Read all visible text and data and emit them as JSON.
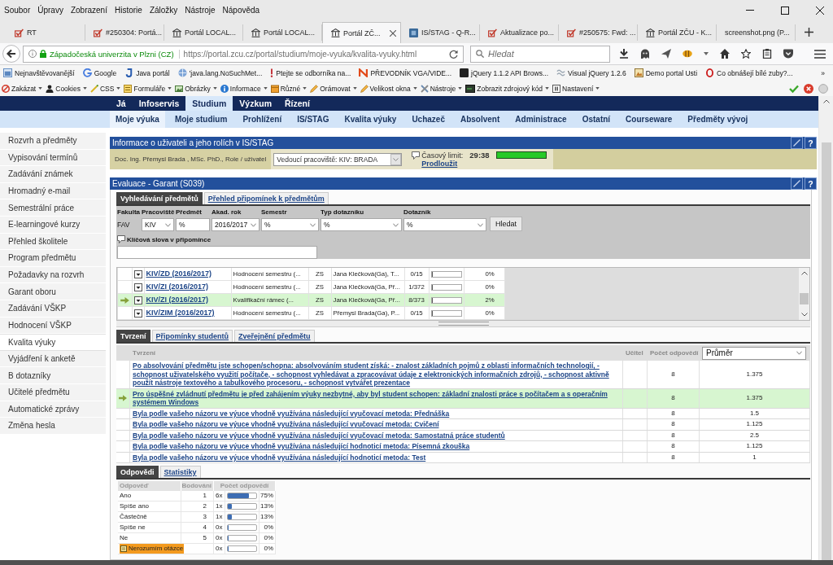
{
  "menu_bar": [
    "Soubor",
    "Úpravy",
    "Zobrazení",
    "Historie",
    "Záložky",
    "Nástroje",
    "Nápověda"
  ],
  "tabs": [
    {
      "label": "RT",
      "kind": "tracker",
      "selected": false
    },
    {
      "label": "#250304: Portá...",
      "kind": "tracker",
      "selected": false
    },
    {
      "label": "Portál LOCAL...",
      "kind": "portal",
      "selected": false
    },
    {
      "label": "Portál LOCAL...",
      "kind": "portal",
      "selected": false
    },
    {
      "label": "Portál ZČ...",
      "kind": "portal",
      "selected": true
    },
    {
      "label": "IS/STAG - Q-R...",
      "kind": "stag",
      "selected": false
    },
    {
      "label": "Aktualizace po...",
      "kind": "tracker",
      "selected": false
    },
    {
      "label": "#250575: Fwd: ...",
      "kind": "tracker",
      "selected": false
    },
    {
      "label": "Portál ZČU - K...",
      "kind": "portal",
      "selected": false
    },
    {
      "label": "screenshot.png (P...",
      "kind": "plain",
      "selected": false
    }
  ],
  "address_bar": {
    "site_identity": "Západočeská univerzita v Plzni (CZ)",
    "url": "https://portal.zcu.cz/portal/studium/moje-vyuka/kvalita-vyuky.html",
    "search_placeholder": "Hledat"
  },
  "bookmarks": [
    {
      "label": "Nejnavštěvovanější",
      "kind": "window"
    },
    {
      "label": "Google",
      "kind": "colorring"
    },
    {
      "label": "Java portál",
      "kind": "hook"
    },
    {
      "label": "'java.lang.NoSuchMet...",
      "kind": "globe"
    },
    {
      "label": "Ptejte se odborníka na...",
      "kind": "exclaim"
    },
    {
      "label": "PŘEVODNÍK VGA/VIDE...",
      "kind": "zigzag"
    },
    {
      "label": "jQuery 1.1.2 API Brows...",
      "kind": "block"
    },
    {
      "label": "Visual jQuery 1.2.6",
      "kind": "wave"
    },
    {
      "label": "Demo portal Usti",
      "kind": "picture"
    },
    {
      "label": "Co obnášejí bílé zuby?...",
      "kind": "ring"
    }
  ],
  "bookmarks_overflow": "»",
  "dev_toolbar": [
    {
      "label": "Zakázat",
      "kind": "prohibit"
    },
    {
      "label": "Cookies",
      "kind": "person"
    },
    {
      "label": "CSS",
      "kind": "wand"
    },
    {
      "label": "Formuláře",
      "kind": "form"
    },
    {
      "label": "Obrázky",
      "kind": "picture"
    },
    {
      "label": "Informace",
      "kind": "info"
    },
    {
      "label": "Různé",
      "kind": "box"
    },
    {
      "label": "Orámovat",
      "kind": "pencil"
    },
    {
      "label": "Velikost okna",
      "kind": "pencil"
    },
    {
      "label": "Nástroje",
      "kind": "tools"
    },
    {
      "label": "Zobrazit zdrojový kód",
      "kind": "console"
    },
    {
      "label": "Nastavení",
      "kind": "panel"
    }
  ],
  "portal": {
    "top_nav": [
      {
        "label": "Já",
        "selected": false
      },
      {
        "label": "Infoservis",
        "selected": false
      },
      {
        "label": "Studium",
        "selected": true
      },
      {
        "label": "Výzkum",
        "selected": false
      },
      {
        "label": "Řízení",
        "selected": false
      }
    ],
    "sub_nav": [
      {
        "label": "Moje výuka",
        "selected": true
      },
      {
        "label": "Moje studium",
        "selected": false
      },
      {
        "label": "Prohlížení",
        "selected": false
      },
      {
        "label": "IS/STAG",
        "selected": false
      },
      {
        "label": "Kvalita výuky",
        "selected": false
      },
      {
        "label": "Uchazeč",
        "selected": false
      },
      {
        "label": "Absolvent",
        "selected": false
      },
      {
        "label": "Administrace",
        "selected": false
      },
      {
        "label": "Ostatní",
        "selected": false
      },
      {
        "label": "Courseware",
        "selected": false
      },
      {
        "label": "Předměty vývoj",
        "selected": false
      }
    ],
    "sidebar": [
      {
        "label": "Rozvrh a předměty",
        "selected": false
      },
      {
        "label": "Vypisování termínů",
        "selected": false
      },
      {
        "label": "Zadávání známek",
        "selected": false
      },
      {
        "label": "Hromadný e-mail",
        "selected": false
      },
      {
        "label": "Semestrální práce",
        "selected": false
      },
      {
        "label": "E-learningové kurzy",
        "selected": false
      },
      {
        "label": "Přehled školitele",
        "selected": false
      },
      {
        "label": "Program předmětu",
        "selected": false
      },
      {
        "label": "Požadavky na rozvrh",
        "selected": false
      },
      {
        "label": "Garant oboru",
        "selected": false
      },
      {
        "label": "Zadávání VŠKP",
        "selected": false
      },
      {
        "label": "Hodnocení VŠKP",
        "selected": false
      },
      {
        "label": "Kvalita výuky",
        "selected": true
      },
      {
        "label": "Vyjádření k anketě",
        "selected": false
      },
      {
        "label": "B dotazníky",
        "selected": false
      },
      {
        "label": "Učitelé předmětu",
        "selected": false
      },
      {
        "label": "Automatické zprávy",
        "selected": false
      },
      {
        "label": "Změna hesla",
        "selected": false
      }
    ],
    "user_panel": {
      "title": "Informace o uživateli a jeho rolích v IS/STAG",
      "help": "?",
      "user": "Doc. Ing. Přemysl Brada , MSc. PhD., Role / uživatel",
      "role": "Vedoucí pracoviště: KIV: BRADA",
      "time_limit": {
        "label": "Časový limit:",
        "value": "29:38",
        "level": 1
      },
      "extend_link": "Prodloužit"
    },
    "evaluation": {
      "title": "Evaluace - Garant (S039)",
      "help": "?",
      "tabs": [
        {
          "label": "Vyhledávání předmětů",
          "selected": true
        },
        {
          "label": "Přehled připomínek k předmětům",
          "selected": false
        }
      ],
      "filters": [
        {
          "label": "Fakulta",
          "value": "FAV",
          "kind": "text"
        },
        {
          "label": "Pracoviště",
          "value": "KIV",
          "kind": "select"
        },
        {
          "label": "Předmět",
          "value": "%",
          "kind": "input"
        },
        {
          "label": "Akad. rok",
          "value": "2016/2017",
          "kind": "select"
        },
        {
          "label": "Semestr",
          "value": "%",
          "kind": "select"
        },
        {
          "label": "Typ dotazníku",
          "value": "%",
          "kind": "select"
        },
        {
          "label": "Dotazník",
          "value": "%",
          "kind": "select"
        }
      ],
      "search_button": "Hledat",
      "keywords_label": "Klíčová slova v připomínce",
      "results": [
        {
          "subject": "KIV/ZD (2016/2017)",
          "questionnaire": "Hodnocení semestru (...",
          "semester": "ZS",
          "teachers": "Jana Klečková(Ga), T...",
          "count": "0/15",
          "level": 0,
          "percent": "0%",
          "selected": false
        },
        {
          "subject": "KIV/ZI (2016/2017)",
          "questionnaire": "Hodnocení semestru (...",
          "semester": "ZS",
          "teachers": "Jana Klečková(Ga, Př...",
          "count": "1/372",
          "level": 0,
          "percent": "0%",
          "selected": false
        },
        {
          "subject": "KIV/ZI (2016/2017)",
          "questionnaire": "Kvalifikační rámec (...",
          "semester": "ZS",
          "teachers": "Jana Klečková(Ga, Př...",
          "count": "8/373",
          "level": 0.02,
          "percent": "2%",
          "selected": true
        },
        {
          "subject": "KIV/ZIM (2016/2017)",
          "questionnaire": "Hodnocení semestru (...",
          "semester": "ZS",
          "teachers": "Přemysl Brada(Ga), P...",
          "count": "0/15",
          "level": 0,
          "percent": "0%",
          "selected": false
        }
      ],
      "detail_tabs": [
        {
          "label": "Tvrzení",
          "selected": true
        },
        {
          "label": "Připomínky studentů",
          "selected": false
        },
        {
          "label": "Zveřejnění předmětu",
          "selected": false
        }
      ],
      "statements": {
        "columns": [
          "Tvrzení",
          "Učitel",
          "Počet odpovědí"
        ],
        "aggregate": "Průměr",
        "rows": [
          {
            "text": "Po absolvování předmětu jste schopen/schopna: absolvováním student získá: - znalost základních pojmů z oblasti informačních technologií, - schopnost uživatelského využití počítače, - schopnost vyhledávat a zpracovávat údaje z elektronických informačních zdrojů, - schopnost aktivně použít nástroje textového a tabulkového procesoru, - schopnost vytvářet prezentace",
            "count": "8",
            "average": "1.375",
            "selected": false
          },
          {
            "text": "Pro úspěšné zvládnutí předmětu je před zahájením výuky nezbytné, aby byl student schopen: základní znalosti práce s počítačem a s operačním systémem Windows",
            "count": "8",
            "average": "1.375",
            "selected": true
          },
          {
            "text": "Byla podle vašeho názoru ve výuce vhodně využívána následující vyučovací metoda: Přednáška",
            "count": "8",
            "average": "1.5",
            "selected": false
          },
          {
            "text": "Byla podle vašeho názoru ve výuce vhodně využívána následující vyučovací metoda: Cvičení",
            "count": "8",
            "average": "1.125",
            "selected": false
          },
          {
            "text": "Byla podle vašeho názoru ve výuce vhodně využívána následující vyučovací metoda: Samostatná práce studentů",
            "count": "8",
            "average": "2.5",
            "selected": false
          },
          {
            "text": "Byla podle vašeho názoru ve výuce vhodně využívána následující hodnoticí metoda: Písemná zkouška",
            "count": "8",
            "average": "1.125",
            "selected": false
          },
          {
            "text": "Byla podle vašeho názoru ve výuce vhodně využívána následující hodnoticí metoda: Test",
            "count": "8",
            "average": "1",
            "selected": false
          }
        ]
      },
      "answer_tabs": [
        {
          "label": "Odpovědi",
          "selected": true
        },
        {
          "label": "Statistiky",
          "selected": false
        }
      ],
      "answers": {
        "columns": [
          "Odpověď",
          "Bodování",
          "Počet odpovědí"
        ],
        "rows": [
          {
            "kind": "option",
            "label": "Ano",
            "score": "1",
            "count": "6x",
            "level": 0.75,
            "percent": "75%"
          },
          {
            "kind": "option",
            "label": "Spíše ano",
            "score": "2",
            "count": "1x",
            "level": 0.13,
            "percent": "13%"
          },
          {
            "kind": "option",
            "label": "Částečně",
            "score": "3",
            "count": "1x",
            "level": 0.13,
            "percent": "13%"
          },
          {
            "kind": "option",
            "label": "Spíše ne",
            "score": "4",
            "count": "0x",
            "level": 0,
            "percent": "0%"
          },
          {
            "kind": "option",
            "label": "Ne",
            "score": "5",
            "count": "0x",
            "level": 0,
            "percent": "0%"
          },
          {
            "kind": "unclear",
            "label": "Nerozumím otázce",
            "count": "0x",
            "level": 0,
            "percent": "0%"
          }
        ]
      }
    }
  }
}
